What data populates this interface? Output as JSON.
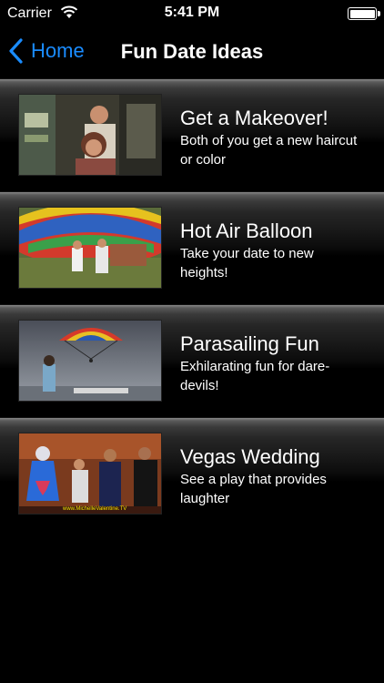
{
  "status_bar": {
    "carrier": "Carrier",
    "time": "5:41 PM"
  },
  "nav": {
    "back_label": "Home",
    "title": "Fun Date Ideas"
  },
  "items": [
    {
      "title": "Get a Makeover!",
      "description": "Both of you get a new haircut or color"
    },
    {
      "title": "Hot Air Balloon",
      "description": "Take your date to new heights!"
    },
    {
      "title": "Parasailing Fun",
      "description": "Exhilarating fun for dare-devils!"
    },
    {
      "title": "Vegas Wedding",
      "description": "See a play that provides laughter",
      "watermark": "www.MichelleValentine.TV"
    }
  ],
  "colors": {
    "accent": "#1a8cff",
    "background": "#000000"
  },
  "icons": [
    "wifi-icon",
    "battery-icon",
    "chevron-left-icon"
  ]
}
